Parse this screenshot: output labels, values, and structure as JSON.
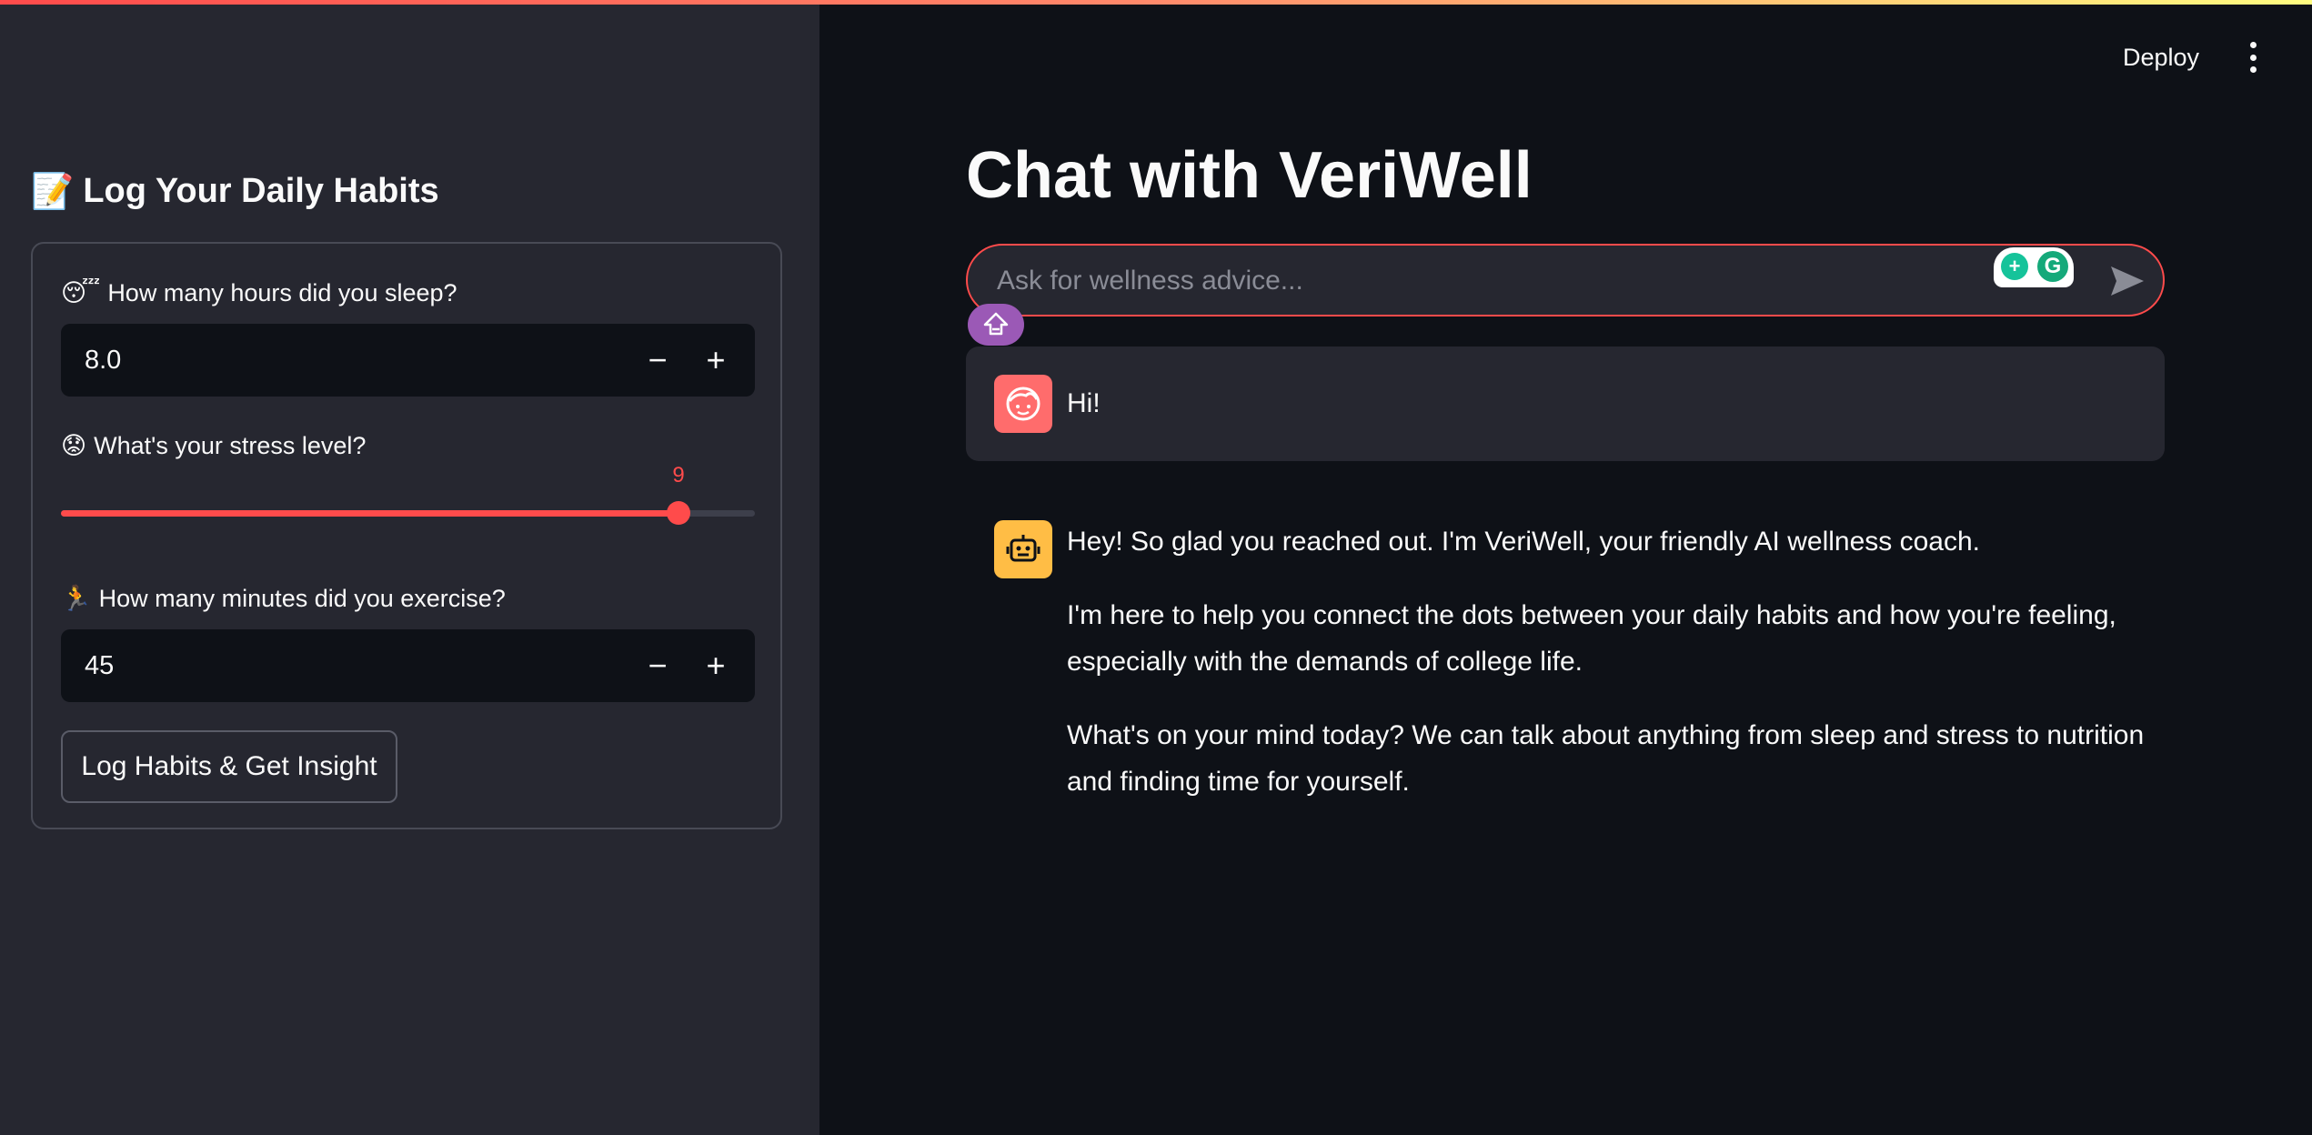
{
  "sidebar": {
    "title_emoji": "📝",
    "title": "Log Your Daily Habits",
    "sleep": {
      "emoji": "😴",
      "label": "How many hours did you sleep?",
      "value": "8.0",
      "minus": "−",
      "plus": "+"
    },
    "stress": {
      "emoji": "😟",
      "label": "What's your stress level?",
      "value": "9",
      "level_fraction": 0.89
    },
    "exercise": {
      "emoji": "🏃",
      "label": "How many minutes did you exercise?",
      "value": "45",
      "minus": "−",
      "plus": "+"
    },
    "submit_label": "Log Habits & Get Insight"
  },
  "header": {
    "deploy_label": "Deploy"
  },
  "main": {
    "title": "Chat with VeriWell",
    "chat_input": {
      "placeholder": "Ask for wellness advice..."
    },
    "messages": [
      {
        "role": "user",
        "text": "Hi!"
      },
      {
        "role": "assistant",
        "paragraphs": [
          "Hey! So glad you reached out. I'm VeriWell, your friendly AI wellness coach.",
          "I'm here to help you connect the dots between your daily habits and how you're feeling, especially with the demands of college life.",
          "What's on your mind today? We can talk about anything from sleep and stress to nutrition and finding time for yourself."
        ]
      }
    ]
  },
  "colors": {
    "accent": "#ff4b4b",
    "background": "#0e1117",
    "sidebar": "#262730",
    "user_avatar": "#ff6c6c",
    "bot_avatar": "#ffbd45"
  }
}
